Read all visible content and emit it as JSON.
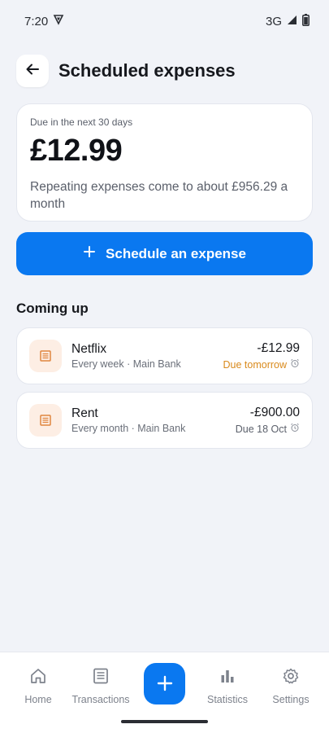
{
  "status": {
    "time": "7:20",
    "network": "3G"
  },
  "header": {
    "title": "Scheduled expenses"
  },
  "summary": {
    "label": "Due in the next 30 days",
    "amount": "£12.99",
    "note": "Repeating expenses come to about £956.29 a month"
  },
  "schedule_button": {
    "icon": "plus-icon",
    "label": "Schedule an expense"
  },
  "coming_up": {
    "title": "Coming up",
    "items": [
      {
        "name": "Netflix",
        "subtitle": "Every week · Main Bank",
        "amount": "-£12.99",
        "due": "Due tomorrow",
        "due_color": "#d98a1c",
        "icon": "receipt-icon"
      },
      {
        "name": "Rent",
        "subtitle": "Every month · Main Bank",
        "amount": "-£900.00",
        "due": "Due 18 Oct",
        "due_color": "#5b606b",
        "icon": "receipt-icon"
      }
    ]
  },
  "bottom_nav": {
    "home": "Home",
    "transactions": "Transactions",
    "statistics": "Statistics",
    "settings": "Settings"
  },
  "colors": {
    "accent": "#0a78f0",
    "background": "#f1f3f8",
    "icon_bg": "#fdeee4",
    "icon_fg": "#e0853f"
  }
}
